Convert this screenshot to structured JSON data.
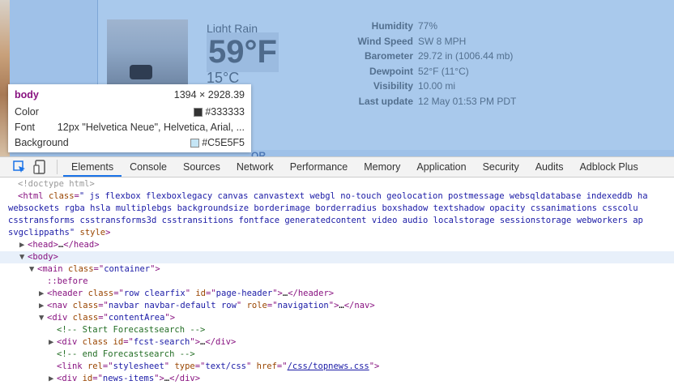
{
  "weather": {
    "condition": "Light Rain",
    "temp_f": "59°F",
    "temp_c": "15°C",
    "stats": [
      {
        "label": "Humidity",
        "value": "77%"
      },
      {
        "label": "Wind Speed",
        "value": "SW 8 MPH"
      },
      {
        "label": "Barometer",
        "value": "29.72 in (1006.44 mb)"
      },
      {
        "label": "Dewpoint",
        "value": "52°F (11°C)"
      },
      {
        "label": "Visibility",
        "value": "10.00 mi"
      },
      {
        "label": "Last update",
        "value": "12 May 01:53 PM PDT"
      }
    ],
    "bottom_caption": "OR"
  },
  "tooltip": {
    "tag": "body",
    "dimensions": "1394 × 2928.39",
    "color_label": "Color",
    "color_value": "#333333",
    "font_label": "Font",
    "font_value": "12px \"Helvetica Neue\", Helvetica, Arial, ...",
    "bg_label": "Background",
    "bg_value": "#C5E5F5"
  },
  "devtools": {
    "tabs": [
      "Elements",
      "Console",
      "Sources",
      "Network",
      "Performance",
      "Memory",
      "Application",
      "Security",
      "Audits",
      "Adblock Plus"
    ],
    "code": {
      "doctype": "<!doctype html>",
      "html_classes_1": "\" js flexbox flexboxlegacy canvas canvastext webgl no-touch geolocation postmessage websqldatabase indexeddb ha",
      "html_classes_2": "websockets rgba hsla multiplebgs backgroundsize borderimage borderradius boxshadow textshadow opacity cssanimations csscolu",
      "html_classes_3": "csstransforms csstransforms3d csstransitions fontface generatedcontent video audio localstorage sessionstorage webworkers ap",
      "html_classes_4": "svgclippaths\"",
      "main_class": "container",
      "header_class": "row clearfix",
      "header_id": "page-header",
      "nav_class": "navbar navbar-default row",
      "nav_role": "navigation",
      "contentarea_class": "contentArea",
      "comment_start": "<!-- Start Forecastsearch -->",
      "fcst_id": "fcst-search",
      "comment_end": "<!-- end Forecastsearch -->",
      "link_rel": "stylesheet",
      "link_type": "text/css",
      "link_href": "/css/topnews.css",
      "last_id": "news-items"
    }
  },
  "colors": {
    "tag": "#881280",
    "attr": "#994500",
    "value": "#1a1aa6",
    "comment": "#236e25",
    "swatch_color": "#333333",
    "swatch_bg": "#C5E5F5"
  }
}
